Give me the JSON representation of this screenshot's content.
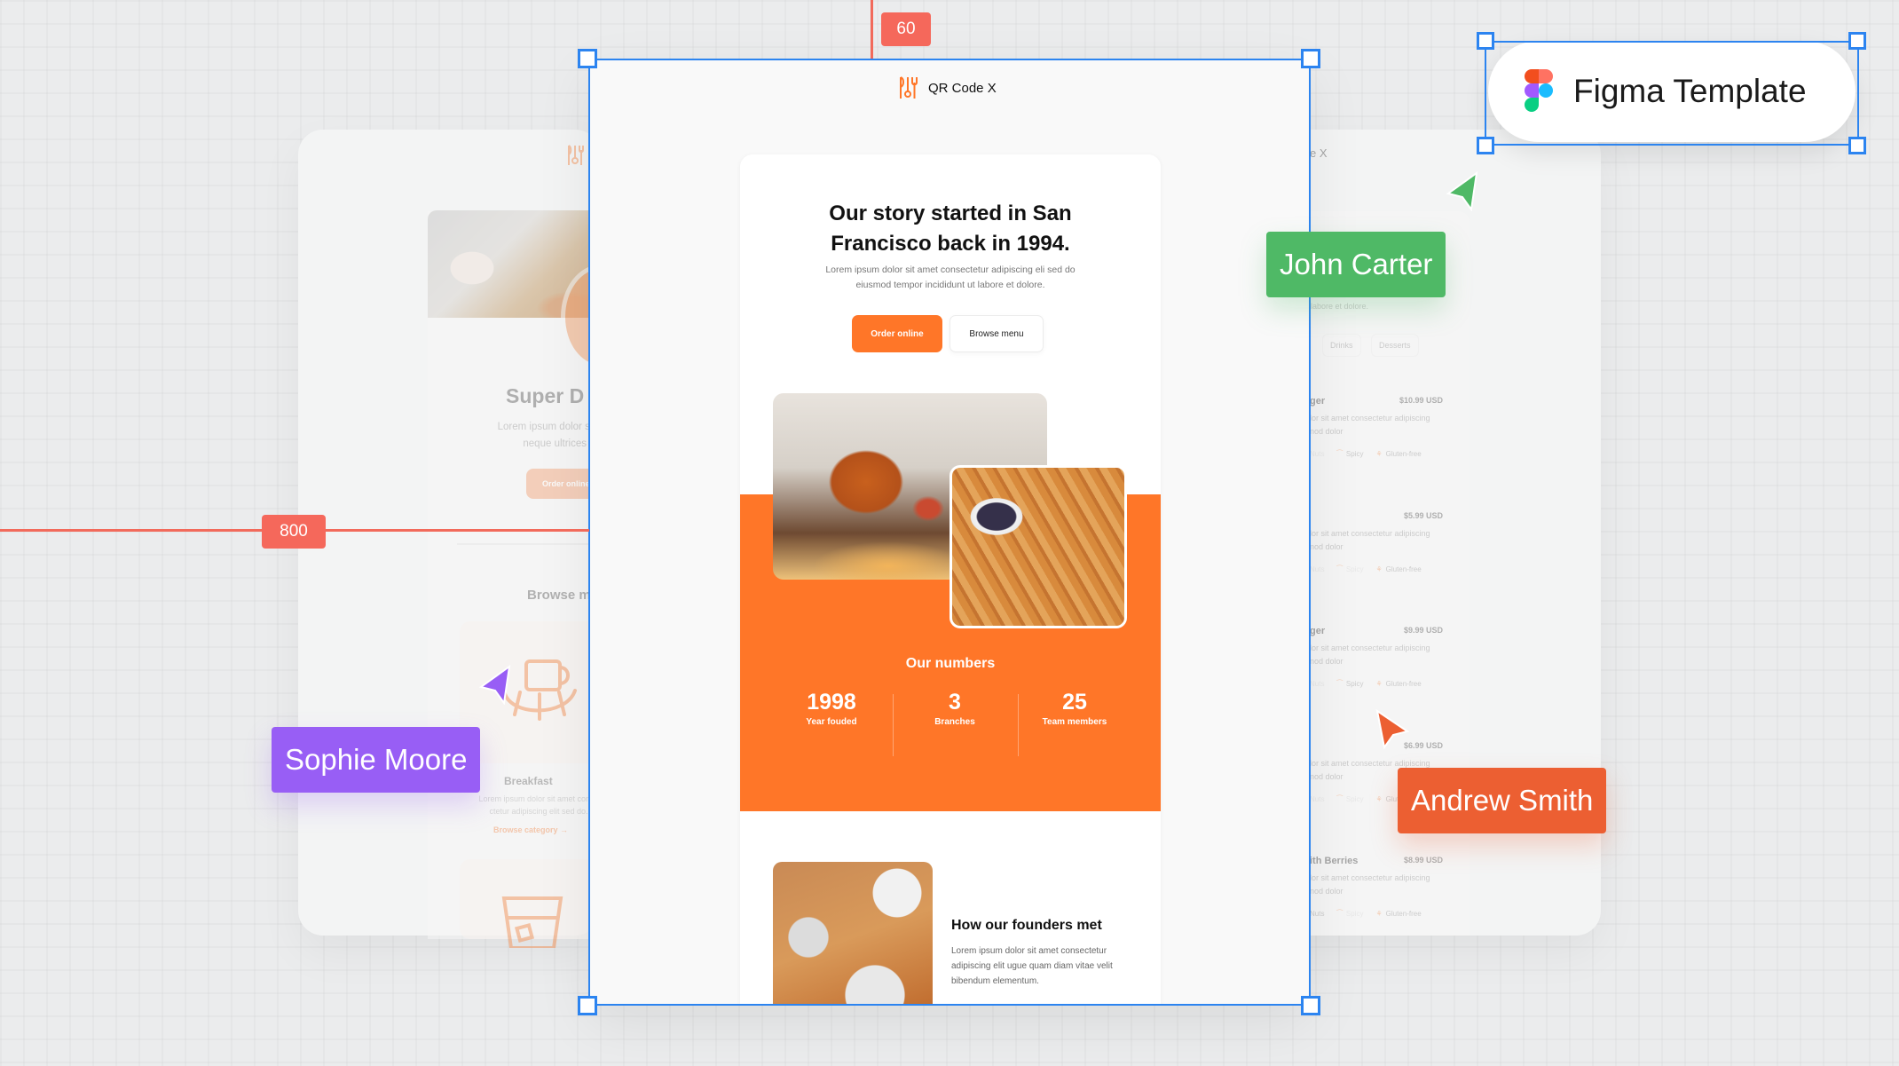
{
  "canvas": {
    "measurement_top": "60",
    "measurement_left": "800",
    "badge_color": "#f5685b",
    "selection_color": "#2c84f0"
  },
  "figma_badge": {
    "label": "Figma Template"
  },
  "collaborators": [
    {
      "name": "John Carter",
      "color": "#4fb966"
    },
    {
      "name": "Sophie Moore",
      "color": "#985ef5"
    },
    {
      "name": "Andrew Smith",
      "color": "#ec5f32"
    }
  ],
  "main_email": {
    "brand": "QR Code X",
    "accent_color": "#ff7628",
    "hero": {
      "title": "Our story started in San Francisco back in 1994.",
      "text": "Lorem ipsum dolor sit amet consectetur adipiscing eli sed do eiusmod tempor incididunt ut labore et dolore.",
      "primary_button": "Order online",
      "secondary_button": "Browse menu"
    },
    "numbers": {
      "title": "Our numbers",
      "stats": [
        {
          "value": "1998",
          "label": "Year fouded"
        },
        {
          "value": "3",
          "label": "Branches"
        },
        {
          "value": "25",
          "label": "Team members"
        }
      ]
    },
    "founders": {
      "title": "How our founders met",
      "text": "Lorem ipsum dolor sit amet consectetur adipiscing elit ugue quam diam vitae velit bibendum elementum."
    }
  },
  "left_card": {
    "title_partial": "Super D",
    "text_partial": "Lorem ipsum dolor sit amet",
    "text_partial_2": "neque ultrices p",
    "button_partial": "Order online",
    "browse_partial": "Browse m",
    "category": {
      "name": "Breakfast",
      "text": "Lorem ipsum dolor sit amet conse ctetur adipiscing elit sed do.",
      "link": "Browse category →"
    }
  },
  "right_card": {
    "brand_partial": "e X",
    "text_partial": "labore et dolore.",
    "tabs": [
      "Drinks",
      "Desserts"
    ],
    "items": [
      {
        "name": "ger",
        "price": "$10.99 USD",
        "desc": "lor sit amet consectetur adipiscing\nnod dolor",
        "tags": [
          "Nuts",
          "Spicy",
          "Gluten-free"
        ],
        "active": [
          false,
          true,
          true
        ]
      },
      {
        "name": "",
        "price": "$5.99 USD",
        "desc": "lor sit amet consectetur adipiscing\nnod dolor",
        "tags": [
          "Nuts",
          "Spicy",
          "Gluten-free"
        ],
        "active": [
          false,
          false,
          true
        ]
      },
      {
        "name": "ger",
        "price": "$9.99 USD",
        "desc": "lor sit amet consectetur adipiscing\nnod dolor",
        "tags": [
          "Nuts",
          "Spicy",
          "Gluten-free"
        ],
        "active": [
          false,
          true,
          true
        ]
      },
      {
        "name": "",
        "price": "$6.99 USD",
        "desc": "lor sit amet consectetur adipiscing\nnod dolor",
        "tags": [
          "Nuts",
          "Spicy",
          "Gluten-free"
        ],
        "active": [
          false,
          false,
          true
        ]
      },
      {
        "name": "ith Berries",
        "price": "$8.99 USD",
        "desc": "lor sit amet consectetur adipiscing\nnod dolor",
        "tags": [
          "Nuts",
          "Spicy",
          "Gluten-free"
        ],
        "active": [
          true,
          false,
          true
        ]
      }
    ]
  }
}
